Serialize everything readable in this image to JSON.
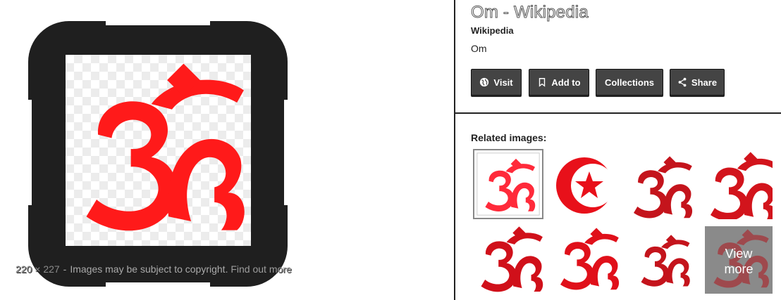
{
  "preview": {
    "dimensions": "220 × 227",
    "separator": "-",
    "copyright_notice": "Images may be subject to copyright.",
    "find_out_more": "Find out more"
  },
  "result": {
    "title": "Om - Wikipedia",
    "site": "Wikipedia",
    "subtitle": "Om"
  },
  "actions": {
    "visit": "Visit",
    "add_to": "Add to",
    "collections": "Collections",
    "share": "Share"
  },
  "related": {
    "label": "Related images:",
    "view_more_line1": "View",
    "view_more_line2": "more"
  },
  "colors": {
    "symbol_red": "#ff1a1a",
    "dark_red": "#c4141c",
    "button_bg": "#444444",
    "frame": "#1f1f1f"
  },
  "icons": {
    "visit": "globe-icon",
    "add_to": "bookmark-icon",
    "share": "share-icon"
  }
}
